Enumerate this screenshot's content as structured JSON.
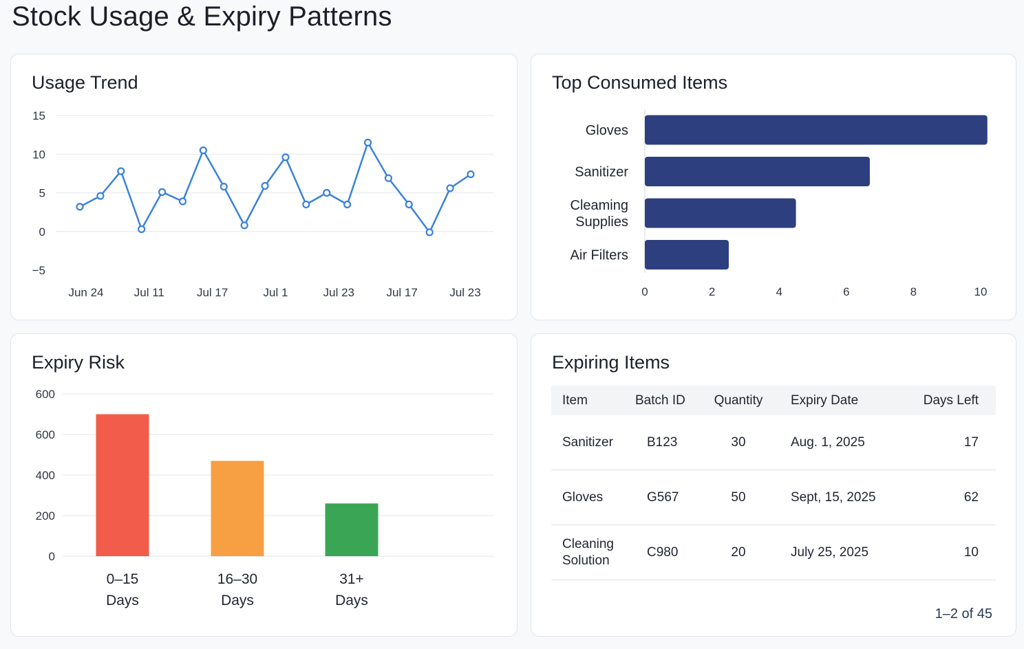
{
  "page": {
    "title": "Stock Usage & Expiry Patterns"
  },
  "usage_trend": {
    "title": "Usage Trend",
    "color": "#3b82d9",
    "chart_data": {
      "type": "line",
      "title": "Usage Trend",
      "y_ticks": [
        15,
        10,
        5,
        0,
        -5
      ],
      "y_tick_labels": [
        "15",
        "10",
        "5",
        "0",
        "−5"
      ],
      "x_tick_labels": [
        "Jun 24",
        "Jul 11",
        "Jul 17",
        "Jul 1",
        "Jul 23",
        "Jul 17",
        "Jul 23"
      ],
      "ylim": [
        -5,
        15
      ],
      "grid": true,
      "series": [
        {
          "values": [
            3.2,
            4.6,
            7.8,
            0.3,
            5.1,
            3.9,
            10.5,
            5.8,
            0.8,
            5.9,
            9.6,
            3.5,
            5.0,
            3.5,
            11.5,
            6.9,
            3.5,
            -0.1,
            5.6,
            7.4
          ]
        }
      ]
    }
  },
  "top_consumed": {
    "title": "Top Consumed Items",
    "color": "#2e3f7f",
    "chart_data": {
      "type": "bar",
      "orientation": "horizontal",
      "title": "Top Consumed Items",
      "categories": [
        "Gloves",
        "Sanitizer",
        "Cleaming Supplies",
        "Air Filters"
      ],
      "category_lines": [
        [
          "Gloves"
        ],
        [
          "Sanitizer"
        ],
        [
          "Cleaming",
          "Supplies"
        ],
        [
          "Air Filters"
        ]
      ],
      "values": [
        10.2,
        6.7,
        4.5,
        2.5
      ],
      "x_ticks": [
        0,
        2,
        4,
        6,
        8,
        10
      ],
      "x_tick_labels": [
        "0",
        "2",
        "4",
        "6",
        "8",
        "10"
      ],
      "xlim": [
        0,
        10
      ]
    }
  },
  "expiry_risk": {
    "title": "Expiry Risk",
    "chart_data": {
      "type": "bar",
      "title": "Expiry Risk",
      "categories": [
        "0–15 Days",
        "16–30 Days",
        "31+ Days"
      ],
      "category_lines": [
        [
          "0–15",
          "Days"
        ],
        [
          "16–30",
          "Days"
        ],
        [
          "31+",
          "Days"
        ]
      ],
      "values": [
        700,
        470,
        260
      ],
      "colors": [
        "#f25c4a",
        "#f6a043",
        "#3aa655"
      ],
      "y_tick_labels": [
        "600",
        "600",
        "400",
        "200",
        "0"
      ],
      "ylim": [
        0,
        800
      ],
      "grid": true
    }
  },
  "expiring_items": {
    "title": "Expiring Items",
    "columns": [
      "Item",
      "Batch ID",
      "Quantity",
      "Expiry Date",
      "Days Left"
    ],
    "rows": [
      {
        "item": "Sanitizer",
        "item_lines": [
          "Sanitizer"
        ],
        "batch": "B123",
        "qty": "30",
        "expiry": "Aug. 1, 2025",
        "days": "17"
      },
      {
        "item": "Gloves",
        "item_lines": [
          "Gloves"
        ],
        "batch": "G567",
        "qty": "50",
        "expiry": "Sept, 15, 2025",
        "days": "62"
      },
      {
        "item": "Cleaning Solution",
        "item_lines": [
          "Cleaning",
          "Solution"
        ],
        "batch": "C980",
        "qty": "20",
        "expiry": "July 25, 2025",
        "days": "10"
      }
    ],
    "pagination": "1–2 of 45"
  }
}
